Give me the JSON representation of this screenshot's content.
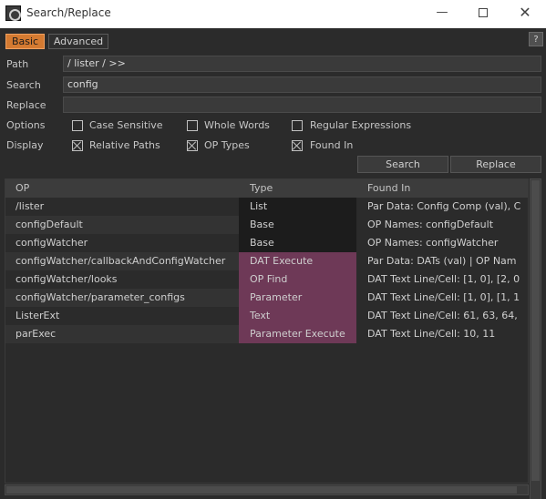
{
  "window": {
    "title": "Search/Replace",
    "minimize_glyph": "—",
    "close_glyph": "✕"
  },
  "tabs": [
    {
      "label": "Basic",
      "active": true
    },
    {
      "label": "Advanced",
      "active": false
    }
  ],
  "help_label": "?",
  "fields": {
    "path": {
      "label": "Path",
      "value": "/ lister / >>"
    },
    "search": {
      "label": "Search",
      "value": "config"
    },
    "replace": {
      "label": "Replace",
      "value": ""
    }
  },
  "options": {
    "label": "Options",
    "items": [
      {
        "label": "Case Sensitive",
        "checked": false
      },
      {
        "label": "Whole Words",
        "checked": false
      },
      {
        "label": "Regular Expressions",
        "checked": false
      }
    ]
  },
  "display": {
    "label": "Display",
    "items": [
      {
        "label": "Relative Paths",
        "checked": true
      },
      {
        "label": "OP Types",
        "checked": true
      },
      {
        "label": "Found In",
        "checked": true
      }
    ]
  },
  "buttons": {
    "search": "Search",
    "replace": "Replace"
  },
  "table": {
    "columns": [
      "OP",
      "Type",
      "Found In"
    ],
    "rows": [
      {
        "op": "/lister",
        "type": "List",
        "found": "Par Data: Config Comp (val), C",
        "op_bg": "#2b2b2b",
        "type_bg": "#1c1c1c"
      },
      {
        "op": "configDefault",
        "type": "Base",
        "found": "OP Names: configDefault",
        "op_bg": "#333333",
        "type_bg": "#1c1c1c"
      },
      {
        "op": "configWatcher",
        "type": "Base",
        "found": "OP Names: configWatcher",
        "op_bg": "#2b2b2b",
        "type_bg": "#1c1c1c"
      },
      {
        "op": "configWatcher/callbackAndConfigWatcher",
        "type": "DAT Execute",
        "found": "Par Data: DATs (val) | OP Nam",
        "op_bg": "#333333",
        "type_bg": "#6e3957"
      },
      {
        "op": "configWatcher/looks",
        "type": "OP Find",
        "found": "DAT Text Line/Cell: [1, 0], [2, 0",
        "op_bg": "#2b2b2b",
        "type_bg": "#6e3957"
      },
      {
        "op": "configWatcher/parameter_configs",
        "type": "Parameter",
        "found": "DAT Text Line/Cell: [1, 0], [1, 1",
        "op_bg": "#333333",
        "type_bg": "#6e3957"
      },
      {
        "op": "ListerExt",
        "type": "Text",
        "found": "DAT Text Line/Cell: 61, 63, 64,",
        "op_bg": "#2b2b2b",
        "type_bg": "#6e3957"
      },
      {
        "op": "parExec",
        "type": "Parameter Execute",
        "found": "DAT Text Line/Cell: 10, 11",
        "op_bg": "#333333",
        "type_bg": "#6e3957"
      }
    ]
  },
  "colors": {
    "accent": "#d47a31",
    "background": "#2b2b2b",
    "type_dat": "#6e3957",
    "type_base": "#1c1c1c"
  }
}
